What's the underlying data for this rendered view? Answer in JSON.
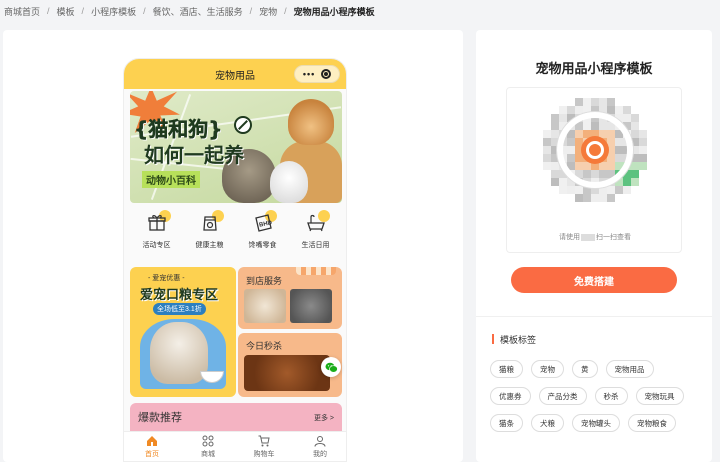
{
  "breadcrumb": {
    "items": [
      "商城首页",
      "模板",
      "小程序模板",
      "餐饮、酒店、生活服务",
      "宠物"
    ],
    "current": "宠物用品小程序模板",
    "separator": "/"
  },
  "phone": {
    "title": "宠物用品",
    "capsule_dots": "•••",
    "banner": {
      "line1": "{猫和狗}",
      "line2": "如何一起养",
      "subtitle": "动物小百科"
    },
    "categories": [
      {
        "label": "活动专区",
        "icon": "gift-icon"
      },
      {
        "label": "健康主粮",
        "icon": "food-bag-icon"
      },
      {
        "label": "馋嘴零食",
        "icon": "bbd-bag-icon"
      },
      {
        "label": "生活日用",
        "icon": "bathtub-icon"
      }
    ],
    "promo_left": {
      "tag": "- 爱宠优惠 -",
      "headline": "爱宠口粮专区",
      "pill": "全场低至3.1折"
    },
    "service": {
      "title": "到店服务"
    },
    "flash": {
      "title": "今日秒杀"
    },
    "hot": {
      "title": "爆款推荐",
      "more": "更多 >"
    },
    "tabs": [
      {
        "label": "首页",
        "icon": "home-icon",
        "active": true
      },
      {
        "label": "商城",
        "icon": "grid-icon",
        "active": false
      },
      {
        "label": "购物车",
        "icon": "cart-icon",
        "active": false
      },
      {
        "label": "我的",
        "icon": "user-icon",
        "active": false
      }
    ]
  },
  "template": {
    "title": "宠物用品小程序模板",
    "qr_caption_before": "请使用",
    "qr_caption_after": "扫一扫查看",
    "build_button": "免费搭建",
    "tags_heading": "模板标签",
    "tags": [
      "猫粮",
      "宠物",
      "黄",
      "宠物用品",
      "优惠券",
      "产品分类",
      "秒杀",
      "宠物玩具",
      "猫条",
      "犬粮",
      "宠物罐头",
      "宠物粮食"
    ]
  },
  "colors": {
    "accent": "#fa6b43",
    "phone_header": "#fdd150",
    "tab_active": "#f08a24",
    "page_bg": "#f3f4f6"
  }
}
